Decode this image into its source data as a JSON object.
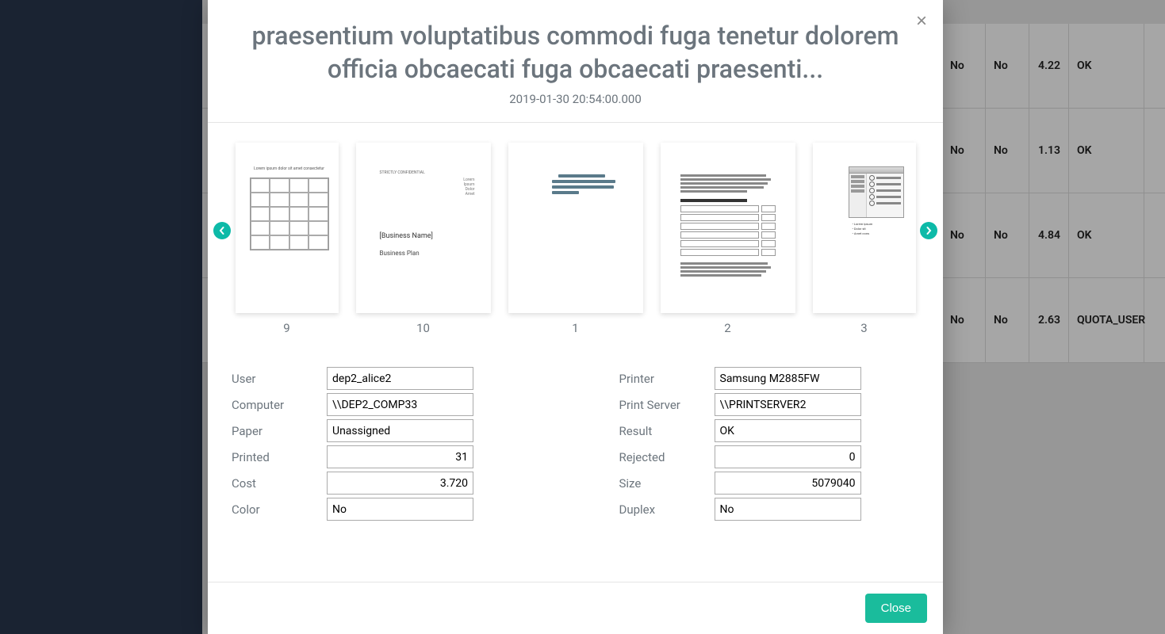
{
  "modal": {
    "title": "praesentium voluptatibus commodi fuga tenetur dolorem officia obcaecati fuga obcaecati praesenti...",
    "timestamp": "2019-01-30 20:54:00.000",
    "close_btn": "Close"
  },
  "carousel": {
    "items": [
      {
        "label": "9"
      },
      {
        "label": "10"
      },
      {
        "label": "1"
      },
      {
        "label": "2"
      },
      {
        "label": "3"
      }
    ]
  },
  "details": {
    "left": {
      "user": {
        "label": "User",
        "value": "dep2_alice2"
      },
      "computer": {
        "label": "Computer",
        "value": "\\\\DEP2_COMP33"
      },
      "paper": {
        "label": "Paper",
        "value": "Unassigned"
      },
      "printed": {
        "label": "Printed",
        "value": "31"
      },
      "cost": {
        "label": "Cost",
        "value": "3.720"
      },
      "color": {
        "label": "Color",
        "value": "No"
      }
    },
    "right": {
      "printer": {
        "label": "Printer",
        "value": "Samsung M2885FW"
      },
      "print_server": {
        "label": "Print Server",
        "value": "\\\\PRINTSERVER2"
      },
      "result": {
        "label": "Result",
        "value": "OK"
      },
      "rejected": {
        "label": "Rejected",
        "value": "0"
      },
      "size": {
        "label": "Size",
        "value": "5079040"
      },
      "duplex": {
        "label": "Duplex",
        "value": "No"
      }
    }
  },
  "bg_table": {
    "rows": [
      {
        "c1": "No",
        "c2": "No",
        "c3": "4.22",
        "c4": "OK"
      },
      {
        "c1": "No",
        "c2": "No",
        "c3": "1.13",
        "c4": "OK"
      },
      {
        "c1": "No",
        "c2": "No",
        "c3": "4.84",
        "c4": "OK"
      },
      {
        "c1": "No",
        "c2": "No",
        "c3": "2.63",
        "c4": "QUOTA_USER"
      }
    ]
  }
}
